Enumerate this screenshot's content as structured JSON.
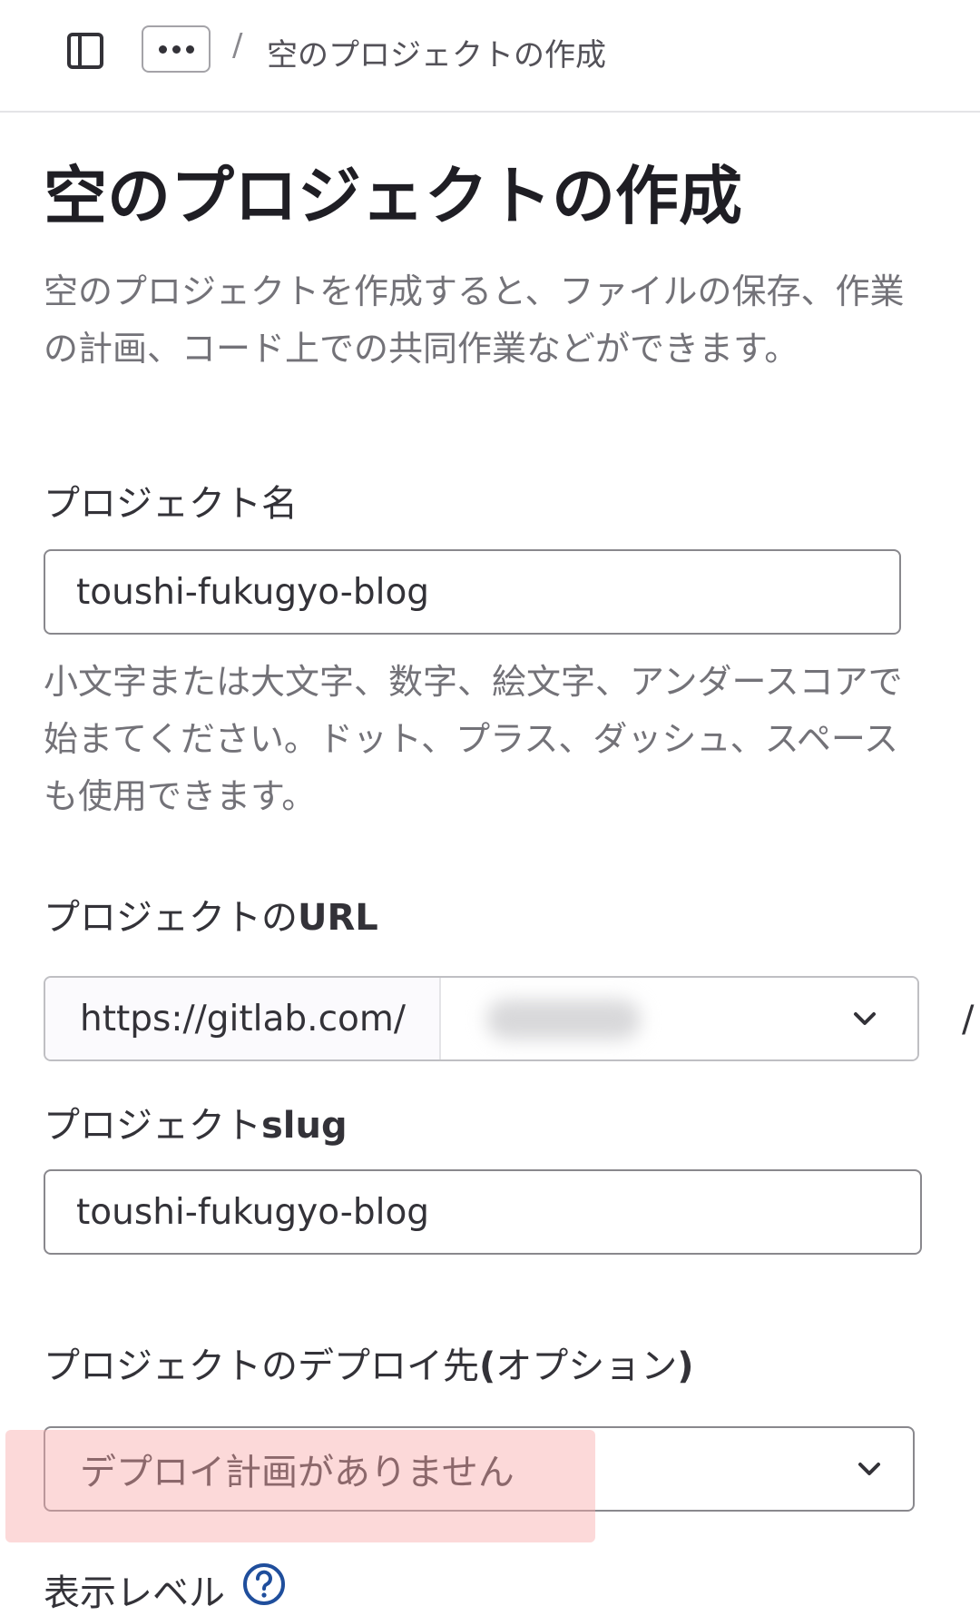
{
  "header": {
    "sidebar_toggle_icon": "sidebar-toggle-icon",
    "more_icon": "ellipsis-icon",
    "breadcrumb_separator": "/",
    "breadcrumb_current": "空のプロジェクトの作成"
  },
  "page": {
    "title": "空のプロジェクトの作成",
    "description": "空のプロジェクトを作成すると、ファイルの保存、作業の計画、コード上での共同作業などができます。"
  },
  "project_name": {
    "label": "プロジェクト名",
    "value": "toushi-fukugyo-blog",
    "help": "小文字または大文字、数字、絵文字、アンダースコアで始まてください。ドット、プラス、ダッシュ、スペースも使用できます。"
  },
  "project_url": {
    "label_prefix": "プロジェクトの",
    "label_bold": "URL",
    "prefix": "https://gitlab.com/",
    "namespace_value": "",
    "separator": "/"
  },
  "project_slug": {
    "label_prefix": "プロジェクト",
    "label_bold": "slug",
    "value": "toushi-fukugyo-blog"
  },
  "deployment": {
    "label_prefix": "プロジェクトのデプロイ先",
    "label_bold_open": "(",
    "label_option": "オプション",
    "label_bold_close": ")",
    "selected": "デプロイ計画がありません"
  },
  "visibility": {
    "label": "表示レベル",
    "help_icon": "question-circle-icon"
  },
  "colors": {
    "highlight": "#f8aaaa",
    "help_icon": "#1f75cb"
  }
}
